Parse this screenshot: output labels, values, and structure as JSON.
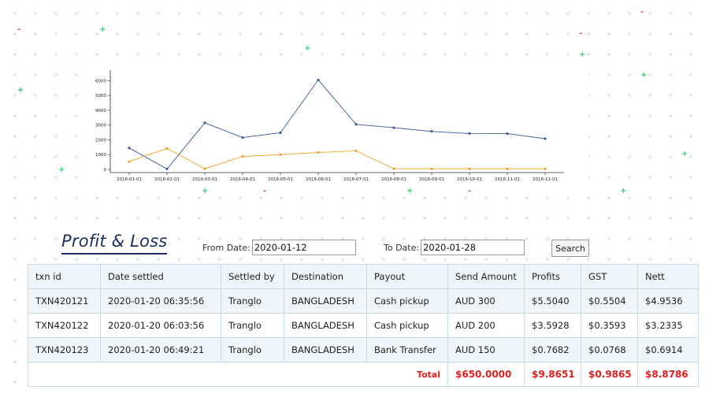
{
  "chart_data": {
    "type": "line",
    "x": [
      "2016-01-01",
      "2016-02-01",
      "2016-03-01",
      "2016-04-01",
      "2016-05-01",
      "2016-06-01",
      "2016-07-01",
      "2016-08-01",
      "2016-09-01",
      "2016-10-01",
      "2016-11-01",
      "2016-12-01"
    ],
    "series": [
      {
        "color": "#3c5a9a",
        "values": [
          1450,
          30,
          3150,
          2150,
          2480,
          6050,
          3050,
          2820,
          2570,
          2430,
          2420,
          2080
        ]
      },
      {
        "color": "#f0a030",
        "values": [
          530,
          1420,
          40,
          880,
          1000,
          1150,
          1260,
          40,
          40,
          40,
          40,
          40
        ]
      }
    ],
    "y_ticks": [
      "0",
      "1000",
      "2000",
      "3000",
      "4000",
      "5000",
      "6000"
    ],
    "ylim": [
      0,
      6500
    ],
    "grid": false
  },
  "page": {
    "title": "Profit & Loss",
    "from_label": "From Date:",
    "from_value": "2020-01-12",
    "to_label": "To Date:",
    "to_value": "2020-01-28",
    "search_label": "Search"
  },
  "table": {
    "headers": [
      "txn id",
      "Date settled",
      "Settled by",
      "Destination",
      "Payout",
      "Send Amount",
      "Profits",
      "GST",
      "Nett"
    ],
    "rows": [
      [
        "TXN420121",
        "2020-01-20 06:35:56",
        "Tranglo",
        "BANGLADESH",
        "Cash pickup",
        "AUD 300",
        "$5.5040",
        "$0.5504",
        "$4.9536"
      ],
      [
        "TXN420122",
        "2020-01-20 06:03:56",
        "Tranglo",
        "BANGLADESH",
        "Cash pickup",
        "AUD 200",
        "$3.5928",
        "$0.3593",
        "$3.2335"
      ],
      [
        "TXN420123",
        "2020-01-20 06:49:21",
        "Tranglo",
        "BANGLADESH",
        "Bank Transfer",
        "AUD 150",
        "$0.7682",
        "$0.0768",
        "$0.6914"
      ]
    ],
    "total": {
      "label": "Total",
      "send_amount": "$650.0000",
      "profits": "$9.8651",
      "gst": "$0.9865",
      "nett": "$8.8786"
    }
  },
  "colors": {
    "accent": "#1c2f5e",
    "total_red": "#e02020",
    "row_alt": "#eef6fc",
    "table_border": "#c7dce8",
    "series_blue": "#3c5a9a",
    "series_orange": "#f0a030"
  }
}
